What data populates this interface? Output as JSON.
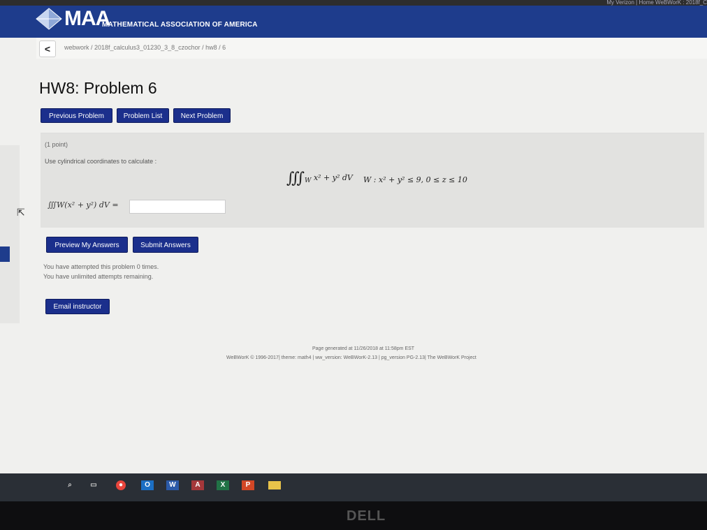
{
  "browser": {
    "tab_text": "My Verizon | Home     WeBWorK : 2018f_C"
  },
  "header": {
    "logo_text": "MAA",
    "org_name": "MATHEMATICAL ASSOCIATION OF AMERICA",
    "brand_color": "#1e3c8c"
  },
  "breadcrumb": {
    "back_label": "<",
    "path": "webwork / 2018f_calculus3_01230_3_8_czochor / hw8 / 6"
  },
  "page_title": "HW8: Problem 6",
  "nav": {
    "previous": "Previous Problem",
    "list": "Problem List",
    "next": "Next Problem"
  },
  "problem": {
    "points": "(1 point)",
    "instructions": "Use cylindrical coordinates to calculate :",
    "integral_symbol": "∭",
    "integral_subscript": "W",
    "integrand": "x² + y² dV",
    "region": "W : x² + y² ≤ 9,    0 ≤ z ≤ 10",
    "answer_label": "∭W(x² + y²) dV =",
    "answer_value": ""
  },
  "actions": {
    "preview": "Preview My Answers",
    "submit": "Submit Answers",
    "email": "Email instructor"
  },
  "attempts": {
    "line1": "You have attempted this problem 0 times.",
    "line2": "You have unlimited attempts remaining."
  },
  "footer": {
    "generated": "Page generated at 11/26/2018 at 11:58pm EST",
    "credits": "WeBWorK © 1996-2017| theme: math4 | ww_version: WeBWorK-2.13 | pg_version PG-2.13| The WeBWorK Project"
  },
  "taskbar": {
    "icons": [
      "search-icon",
      "task-view-icon",
      "chrome-icon",
      "outlook-icon",
      "word-icon",
      "access-icon",
      "excel-icon",
      "powerpoint-icon",
      "file-explorer-icon"
    ]
  },
  "bezel": {
    "brand": "DELL"
  }
}
